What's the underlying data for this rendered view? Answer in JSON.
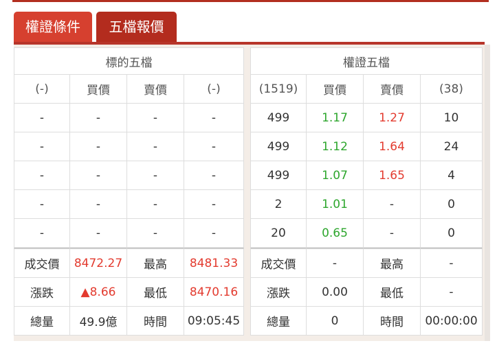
{
  "tabs": [
    "權證條件",
    "五檔報價"
  ],
  "left": {
    "title": "標的五檔",
    "header": [
      "(-)",
      "買價",
      "賣價",
      "(-)"
    ],
    "rows": [
      [
        "-",
        "-",
        "-",
        "-"
      ],
      [
        "-",
        "-",
        "-",
        "-"
      ],
      [
        "-",
        "-",
        "-",
        "-"
      ],
      [
        "-",
        "-",
        "-",
        "-"
      ],
      [
        "-",
        "-",
        "-",
        "-"
      ]
    ],
    "stats": [
      [
        "成交價",
        "8472.27",
        "最高",
        "8481.33"
      ],
      [
        "漲跌",
        "▲8.66",
        "最低",
        "8470.16"
      ],
      [
        "總量",
        "49.9億",
        "時間",
        "09:05:45"
      ]
    ]
  },
  "right": {
    "title": "權證五檔",
    "header": [
      "(1519)",
      "買價",
      "賣價",
      "(38)"
    ],
    "rows": [
      [
        "499",
        "1.17",
        "1.27",
        "10"
      ],
      [
        "499",
        "1.12",
        "1.64",
        "24"
      ],
      [
        "499",
        "1.07",
        "1.65",
        "4"
      ],
      [
        "2",
        "1.01",
        "-",
        "0"
      ],
      [
        "20",
        "0.65",
        "-",
        "0"
      ]
    ],
    "stats": [
      [
        "成交價",
        "-",
        "最高",
        "-"
      ],
      [
        "漲跌",
        "0.00",
        "最低",
        "-"
      ],
      [
        "總量",
        "0",
        "時間",
        "00:00:00"
      ]
    ]
  },
  "colors": {
    "bid": "#2da62d",
    "ask": "#e33b2f",
    "tab_active": "#b32c1e",
    "tab_inactive": "#d6402f"
  }
}
